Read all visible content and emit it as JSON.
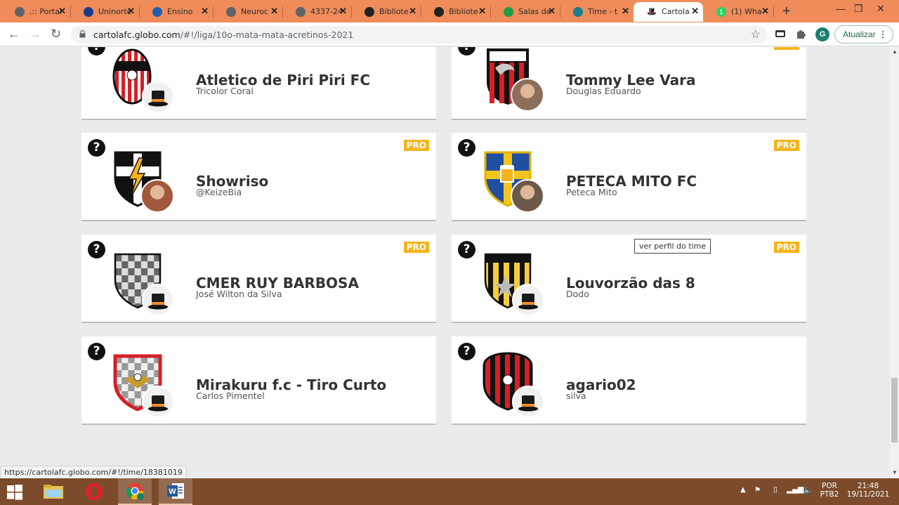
{
  "browser": {
    "tabs": [
      {
        "title": ".:: Portal",
        "icon": "globe-icon",
        "color": "#5f6368"
      },
      {
        "title": "Uninorte",
        "icon": "uninorte-icon",
        "color": "#1a3c8f"
      },
      {
        "title": "Ensino",
        "icon": "play-icon",
        "color": "#1e5fb4"
      },
      {
        "title": "Neuroc",
        "icon": "globe-icon",
        "color": "#5f6368"
      },
      {
        "title": "4337-24",
        "icon": "globe-icon",
        "color": "#5f6368"
      },
      {
        "title": "Bibliote",
        "icon": "library-icon",
        "color": "#222"
      },
      {
        "title": "Bibliote",
        "icon": "library-icon",
        "color": "#222"
      },
      {
        "title": "Salas de",
        "icon": "classroom-icon",
        "color": "#1e9b45"
      },
      {
        "title": "Time - t",
        "icon": "cartola-globe-icon",
        "color": "#1a7f8a"
      },
      {
        "title": "Cartola",
        "icon": "top-hat-icon",
        "color": "#222",
        "active": true
      },
      {
        "title": "(1) Wha",
        "icon": "whatsapp-icon",
        "color": "#25d366"
      }
    ],
    "url_host": "cartolafc.globo.com",
    "url_path": "/#!/liga/10o-mata-mata-acretinos-2021",
    "update_label": "Atualizar",
    "profile_initial": "G",
    "status_url": "https://cartolafc.globo.com/#!/time/18381019"
  },
  "teams": [
    {
      "name": "Atletico de Piri Piri FC",
      "owner": "Tricolor Coral",
      "pro": false,
      "crest": "red-white-stripes",
      "avatar": "cartola"
    },
    {
      "name": "Tommy Lee Vara",
      "owner": "Douglas Eduardo",
      "pro": true,
      "crest": "red-black-flamengo",
      "avatar": "photo"
    },
    {
      "name": "Showriso",
      "owner": "@KeizeBia",
      "pro": true,
      "crest": "black-lightning",
      "avatar": "photo"
    },
    {
      "name": "PETECA MITO FC",
      "owner": "Peteca Mito",
      "pro": true,
      "crest": "blue-yellow-beer",
      "avatar": "photo"
    },
    {
      "name": "CMER RUY BARBOSA",
      "owner": "José Wilton da Silva",
      "pro": true,
      "crest": "checkered-gray",
      "avatar": "cartola"
    },
    {
      "name": "Louvorzão das 8",
      "owner": "Dodo",
      "pro": true,
      "crest": "yellow-black-stripes",
      "avatar": "cartola"
    },
    {
      "name": "Mirakuru f.c - Tiro Curto",
      "owner": "Carlos Pimentel",
      "pro": false,
      "crest": "red-checkered",
      "avatar": "cartola"
    },
    {
      "name": "agario02",
      "owner": "silva",
      "pro": false,
      "crest": "red-black-stripes",
      "avatar": "cartola"
    }
  ],
  "pro_label": "PRO",
  "help_label": "?",
  "tooltip": "ver perfil do time",
  "taskbar": {
    "language_top": "POR",
    "language_bottom": "PTB2",
    "time": "21:48",
    "date": "19/11/2021"
  }
}
